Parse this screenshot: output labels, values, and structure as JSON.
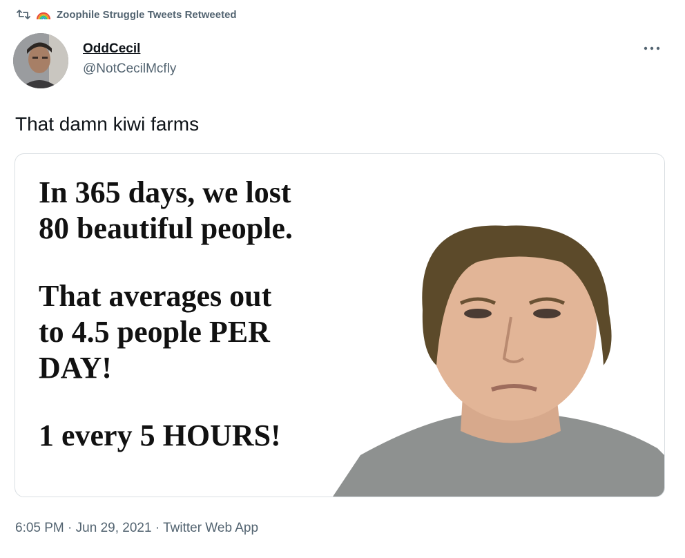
{
  "retweet": {
    "label": "Zoophile Struggle Tweets Retweeted",
    "icon": "retweet-icon",
    "emoji_icon": "rainbow-icon"
  },
  "author": {
    "display_name": "OddCecil",
    "handle": "@NotCecilMcfly"
  },
  "tweet": {
    "text": "That damn kiwi farms"
  },
  "media": {
    "lines": [
      "In 365 days, we lost",
      "80 beautiful people.",
      "That averages out",
      "to 4.5 people PER",
      "DAY!",
      "1 every 5 HOURS!"
    ]
  },
  "meta": {
    "time": "6:05 PM",
    "separator": " · ",
    "date": "Jun 29, 2021",
    "source": "Twitter Web App"
  },
  "colors": {
    "text": "#0f1419",
    "secondary": "#536471",
    "border": "#d9dee2"
  }
}
